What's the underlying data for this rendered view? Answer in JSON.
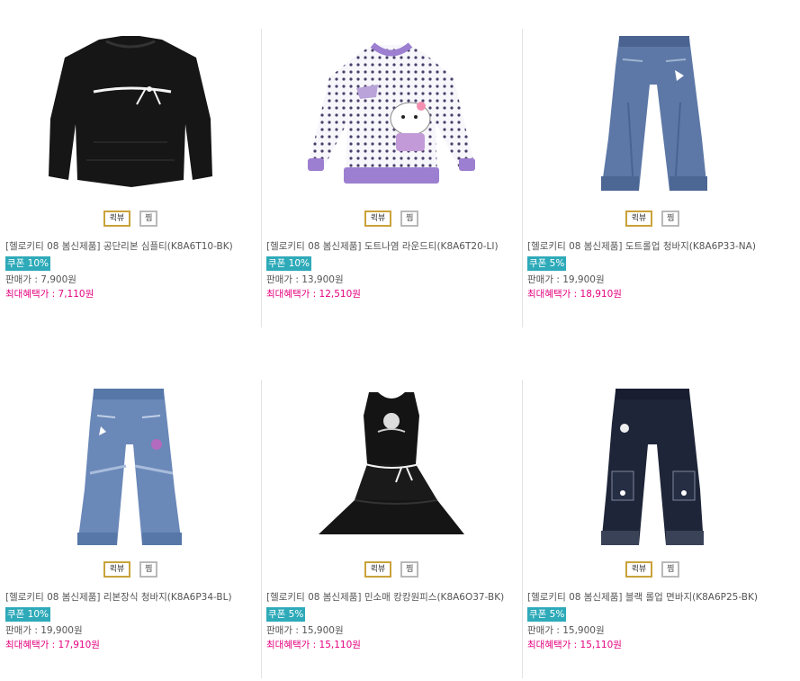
{
  "buttons": {
    "quickview": "퀵뷰",
    "wish": "찜"
  },
  "labels": {
    "sale_price": "판매가 : ",
    "max_benefit": "최대혜택가 : "
  },
  "colors": {
    "coupon_bg": "#2eaab9",
    "max_benefit_text": "#e5007e",
    "quickview_border": "#c9a23a"
  },
  "products": [
    {
      "name": "[헬로키티 08 봄신제품] 공단리본 심플티(K8A6T10-BK)",
      "image": "black-long-sleeve-top",
      "coupon": "쿠폰 10%",
      "price": "7,900원",
      "max_price": "7,110원"
    },
    {
      "name": "[헬로키티 08 봄신제품] 도트나염 라운드티(K8A6T20-LI)",
      "image": "polka-dot-hello-kitty-sweatshirt",
      "coupon": "쿠폰 10%",
      "price": "13,900원",
      "max_price": "12,510원"
    },
    {
      "name": "[헬로키티 08 봄신제품] 도트롤업 청바지(K8A6P33-NA)",
      "image": "blue-jeans",
      "coupon": "쿠폰 5%",
      "price": "19,900원",
      "max_price": "18,910원"
    },
    {
      "name": "[헬로키티 08 봄신제품] 리본장식 청바지(K8A6P34-BL)",
      "image": "ribbon-jeans",
      "coupon": "쿠폰 10%",
      "price": "19,900원",
      "max_price": "17,910원"
    },
    {
      "name": "[헬로키티 08 봄신제품] 민소매 캉캉원피스(K8A6O37-BK)",
      "image": "black-sleeveless-dress",
      "coupon": "쿠폰 5%",
      "price": "15,900원",
      "max_price": "15,110원"
    },
    {
      "name": "[헬로키티 08 봄신제품] 블랙 롤업 면바지(K8A6P25-BK)",
      "image": "black-cargo-pants",
      "coupon": "쿠폰 5%",
      "price": "15,900원",
      "max_price": "15,110원"
    }
  ]
}
